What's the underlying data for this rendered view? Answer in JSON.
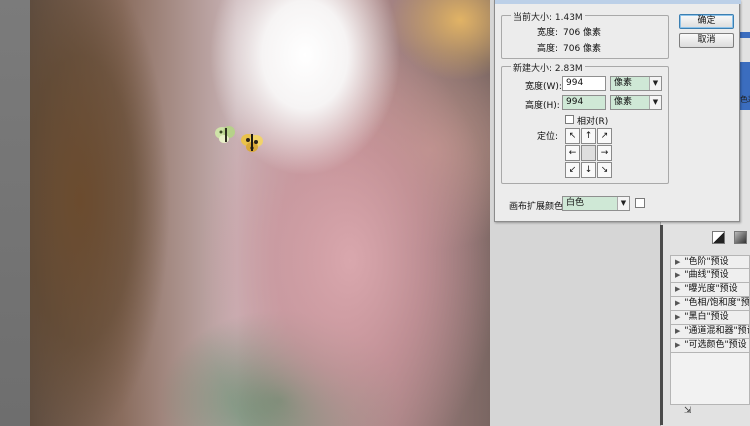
{
  "dialog": {
    "current_size_label": "当前大小: 1.43M",
    "current_width_label": "宽度:",
    "current_width_value": "706 像素",
    "current_height_label": "高度:",
    "current_height_value": "706 像素",
    "new_size_label": "新建大小: 2.83M",
    "width_label": "宽度(W):",
    "width_value": "994",
    "width_unit": "像素",
    "height_label": "高度(H):",
    "height_value": "994",
    "height_unit": "像素",
    "relative_label": "相对(R)",
    "anchor_label": "定位:",
    "anchor_arrows": [
      "↖",
      "↑",
      "↗",
      "←",
      "",
      "→",
      "↙",
      "↓",
      "↘"
    ],
    "extension_color_label": "画布扩展颜色:",
    "extension_color_value": "白色",
    "ok_label": "确定",
    "cancel_label": "取消"
  },
  "presets": [
    "\"色阶\"预设",
    "\"曲线\"预设",
    "\"曝光度\"预设",
    "\"色相/饱和度\"预设",
    "\"黑白\"预设",
    "\"通道混和器\"预设",
    "\"可选颜色\"预设"
  ],
  "colors": {
    "selection_green": "#cfe8d6",
    "dialog_bg": "#ececec",
    "accent_blue": "#3b6dbf"
  },
  "icons": {
    "dropdown_arrow": "▼",
    "expand_triangle": "▶"
  }
}
